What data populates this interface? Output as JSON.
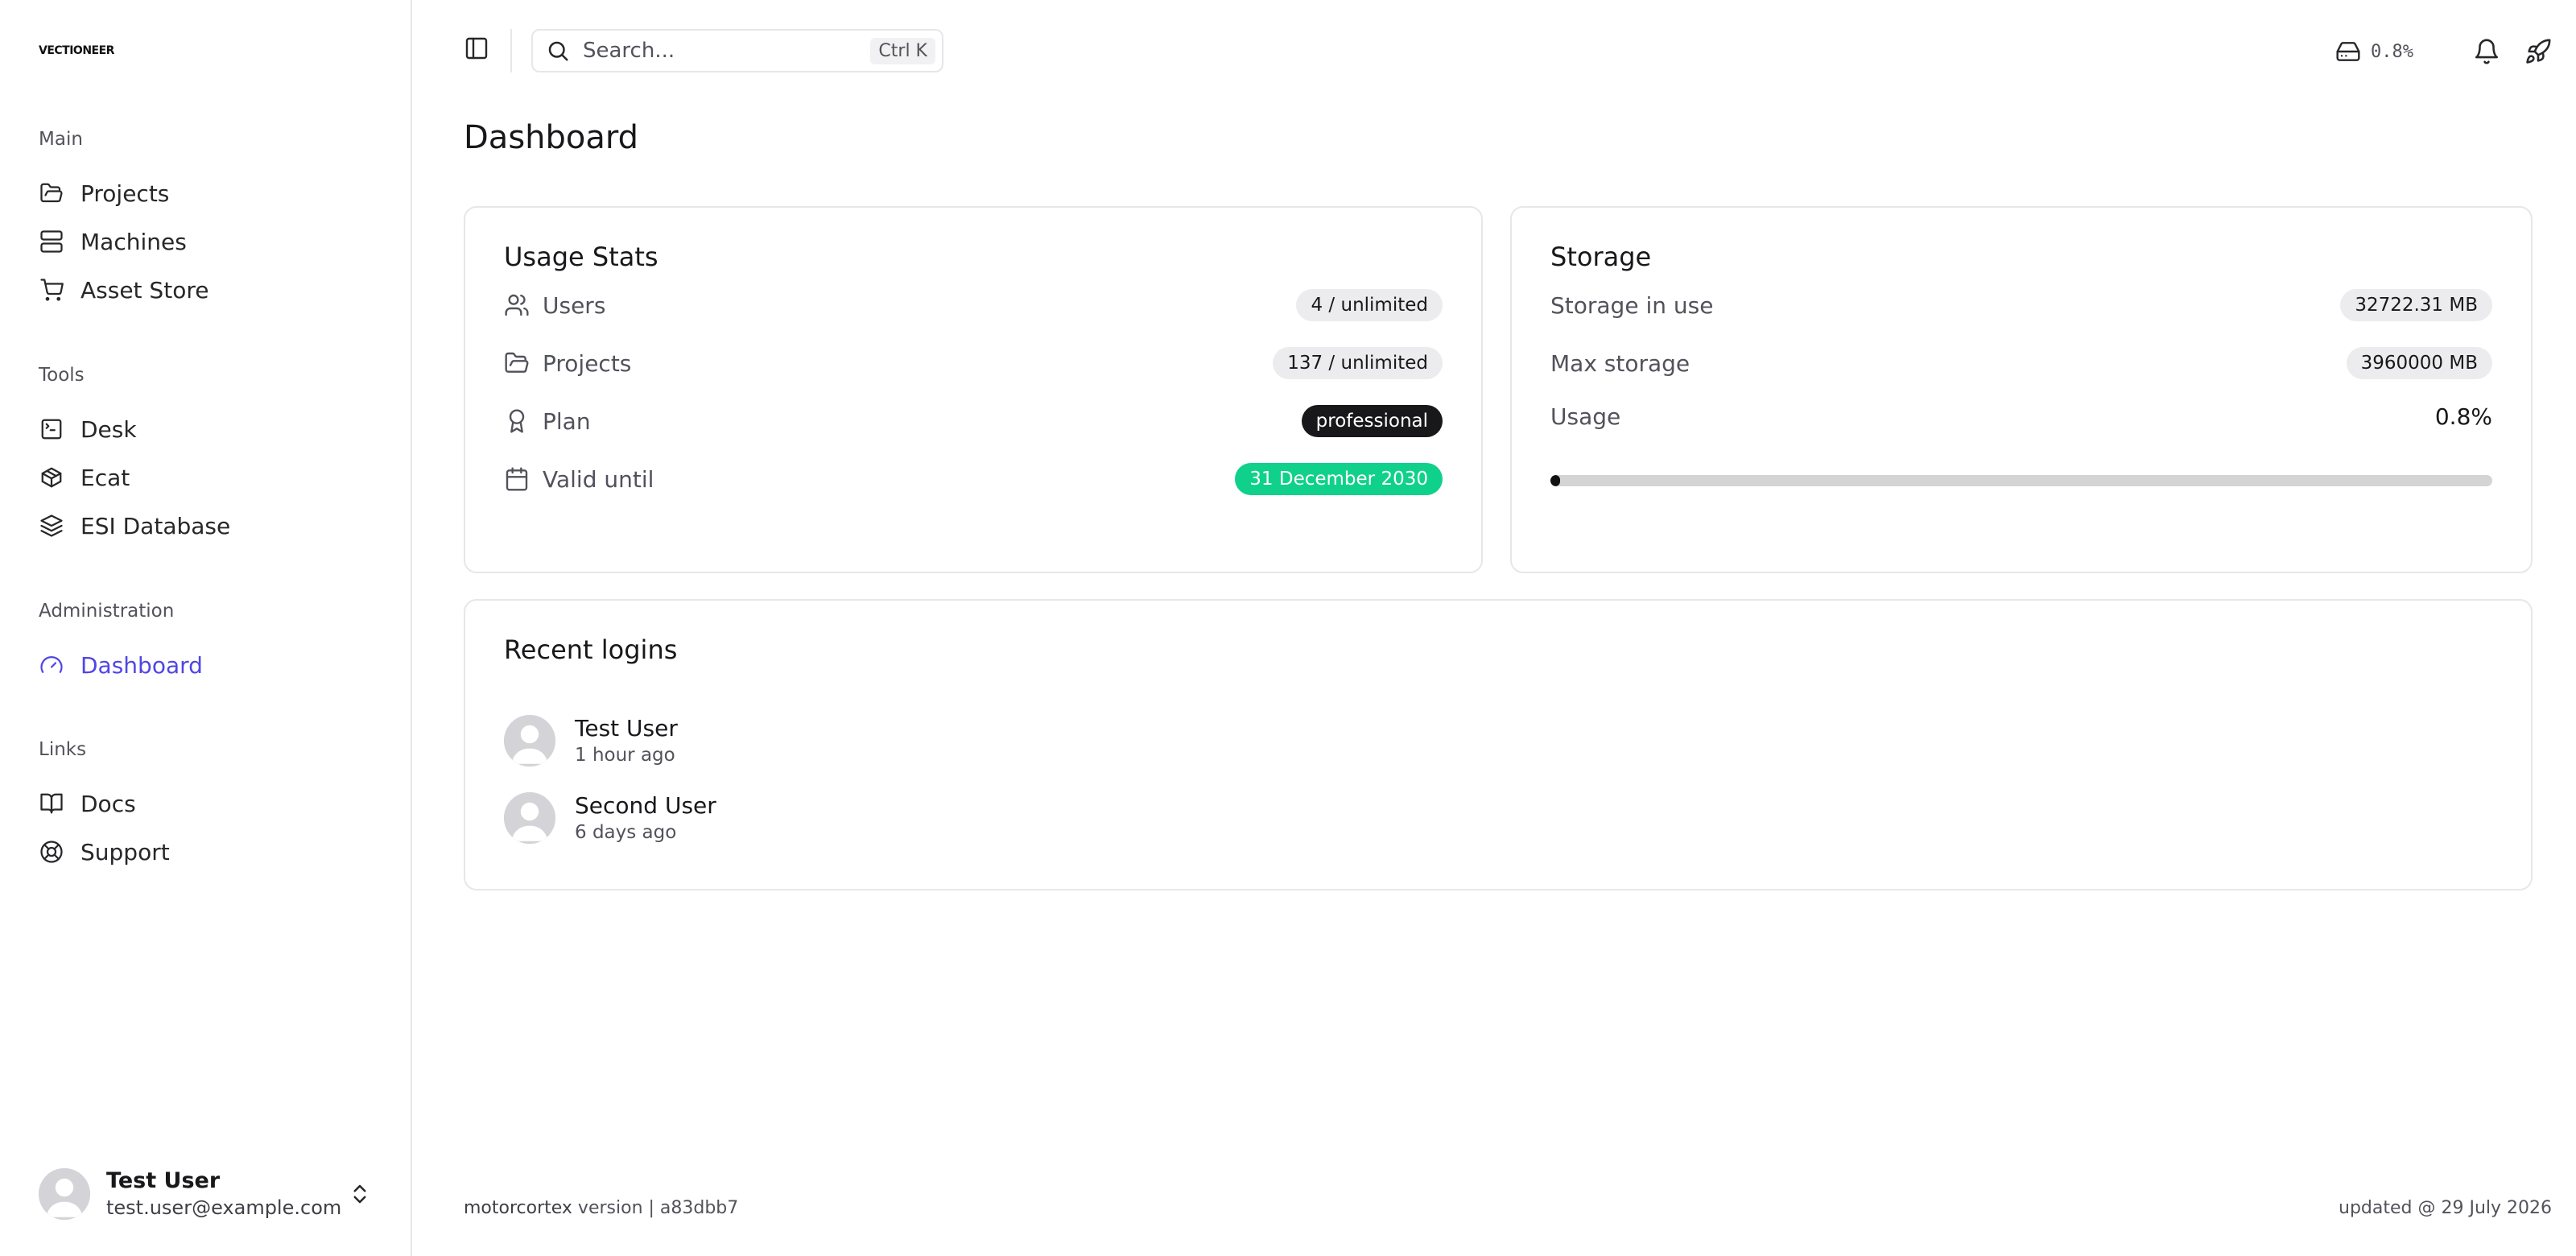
{
  "sidebar": {
    "logo": "VECTIONEER",
    "groups": [
      {
        "label": "Main",
        "items": [
          {
            "label": "Projects",
            "icon": "folder-open-icon"
          },
          {
            "label": "Machines",
            "icon": "server-icon"
          },
          {
            "label": "Asset Store",
            "icon": "shopping-cart-icon"
          }
        ]
      },
      {
        "label": "Tools",
        "items": [
          {
            "label": "Desk",
            "icon": "terminal-square-icon"
          },
          {
            "label": "Ecat",
            "icon": "package-icon"
          },
          {
            "label": "ESI Database",
            "icon": "layers-icon"
          }
        ]
      },
      {
        "label": "Administration",
        "items": [
          {
            "label": "Dashboard",
            "icon": "gauge-icon",
            "active": true
          }
        ]
      },
      {
        "label": "Links",
        "items": [
          {
            "label": "Docs",
            "icon": "book-open-icon"
          },
          {
            "label": "Support",
            "icon": "life-buoy-icon"
          }
        ]
      }
    ],
    "user": {
      "name": "Test User",
      "email": "test.user@example.com"
    }
  },
  "topbar": {
    "search_placeholder": "Search...",
    "shortcut": "Ctrl K",
    "storage_percent": "0.8%"
  },
  "page": {
    "title": "Dashboard"
  },
  "usage_stats": {
    "title": "Usage Stats",
    "rows": [
      {
        "label": "Users",
        "value": "4 / unlimited",
        "icon": "users-icon"
      },
      {
        "label": "Projects",
        "value": "137 / unlimited",
        "icon": "folder-open-icon"
      },
      {
        "label": "Plan",
        "value": "professional",
        "icon": "award-icon"
      },
      {
        "label": "Valid until",
        "value": "31 December 2030",
        "icon": "calendar-icon"
      }
    ]
  },
  "storage": {
    "title": "Storage",
    "in_use_label": "Storage in use",
    "in_use_value": "32722.31 MB",
    "max_label": "Max storage",
    "max_value": "3960000 MB",
    "usage_label": "Usage",
    "usage_value": "0.8%",
    "usage_fraction": 0.008
  },
  "recent_logins": {
    "title": "Recent logins",
    "items": [
      {
        "name": "Test User",
        "time": "1 hour ago"
      },
      {
        "name": "Second User",
        "time": "6 days ago"
      }
    ]
  },
  "footer": {
    "brand": "motorcortex",
    "version_text": " version | a83dbb7",
    "updated": "updated @ 29 July 2026"
  },
  "colors": {
    "accent": "#4f46e5",
    "success": "#10d18b",
    "dark": "#18181b"
  }
}
